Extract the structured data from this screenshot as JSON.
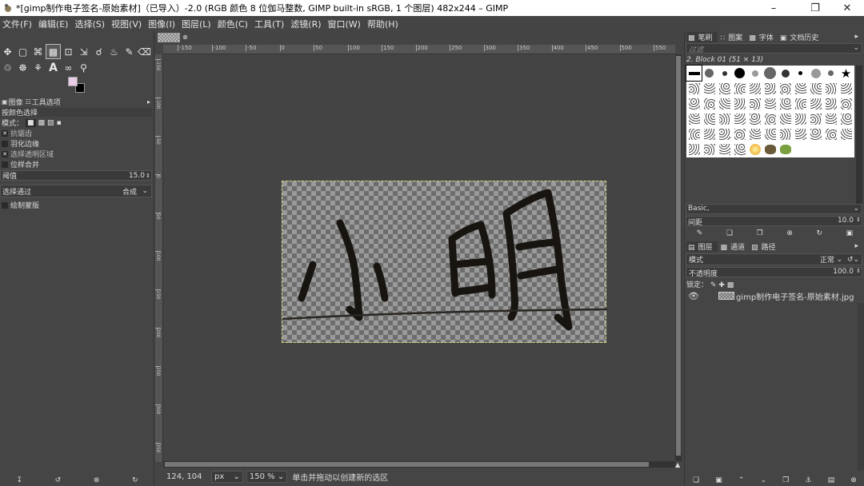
{
  "window": {
    "title": "*[gimp制作电子签名-原始素材]（已导入）-2.0 (RGB 颜色 8 位伽马整数, GIMP built-in sRGB, 1 个图层) 482x244 – GIMP",
    "minimize_icon": "minimize-icon",
    "maximize_icon": "maximize-icon",
    "close_icon": "close-icon"
  },
  "menu": [
    "文件(F)",
    "编辑(E)",
    "选择(S)",
    "视图(V)",
    "图像(I)",
    "图层(L)",
    "颜色(C)",
    "工具(T)",
    "滤镜(R)",
    "窗口(W)",
    "帮助(H)"
  ],
  "toolbox": {
    "row1": [
      "move-icon",
      "rect-select-icon",
      "lasso-icon",
      "fuzzy-select-icon",
      "crop-icon",
      "transform-icon",
      "warp-icon",
      "bucket-fill-icon",
      "paintbrush-icon",
      "eraser-icon"
    ],
    "row2": [
      "clone-icon",
      "smudge-icon",
      "dodge-icon",
      "text-icon",
      "color-picker-icon",
      "zoom-icon"
    ]
  },
  "tool_options": {
    "tabs": [
      "图像",
      "工具选项"
    ],
    "title": "按颜色选择",
    "mode_label": "模式：",
    "antialias": "抗锯齿",
    "feather": "羽化边缘",
    "select_transparent": "选择透明区域",
    "sample_merged": "位样合并",
    "threshold_label": "阈值",
    "threshold_value": "15.0",
    "select_by_label": "选择通过",
    "select_by_value": "合成",
    "draw_mask": "绘制蒙版"
  },
  "ruler_ticks": [
    "-150",
    "-100",
    "-50",
    "0",
    "50",
    "100",
    "150",
    "200",
    "250",
    "300",
    "350",
    "400",
    "450",
    "500",
    "550"
  ],
  "vruler_ticks": [
    "-150",
    "-100",
    "-50",
    "0",
    "50",
    "100",
    "150",
    "200",
    "250",
    "300",
    "350"
  ],
  "handwriting": {
    "char_1": "小",
    "char_2": "明"
  },
  "status": {
    "coords": "124, 104",
    "unit": "px",
    "zoom": "150 %",
    "message": "单击并拖动以创建新的选区"
  },
  "right_dock": {
    "brush_tabs": [
      "笔刷",
      "图案",
      "字体",
      "文档历史"
    ],
    "filter_placeholder": "过滤",
    "brush_name": "2. Block 01 (51 × 13)",
    "brush_preset": "Basic,",
    "spacing_label": "间距",
    "spacing_value": "10.0",
    "layer_tabs": [
      "图层",
      "通道",
      "路径"
    ],
    "mode_label": "模式",
    "mode_value": "正常",
    "opacity_label": "不透明度",
    "opacity_value": "100.0",
    "lock_label": "锁定：",
    "layer_name": "gimp制作电子签名-原始素材.jpg"
  },
  "colors": {
    "fg": "#e9cde6",
    "bg": "#000000",
    "accent": "#d9d97a"
  }
}
